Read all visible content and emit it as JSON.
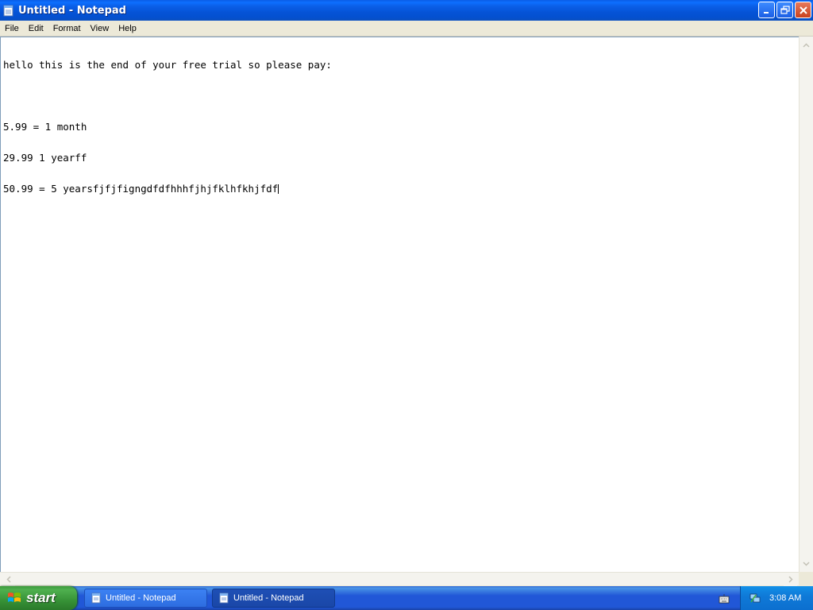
{
  "window": {
    "title": "Untitled - Notepad"
  },
  "menu": {
    "items": [
      "File",
      "Edit",
      "Format",
      "View",
      "Help"
    ]
  },
  "editor": {
    "lines": [
      "hello this is the end of your free trial so please pay:",
      "",
      "5.99 = 1 month",
      "29.99 1 yearff",
      "50.99 = 5 yearsfjfjfigngdfdfhhhfjhjfklhfkhjfdf"
    ]
  },
  "taskbar": {
    "start_label": "start",
    "buttons": [
      {
        "label": "Untitled - Notepad",
        "active": false
      },
      {
        "label": "Untitled - Notepad",
        "active": true
      }
    ],
    "clock": "3:08 AM"
  },
  "colors": {
    "titlebar": "#0553d6",
    "taskbar": "#2157d7",
    "start_button": "#379237",
    "close_button": "#c9411e"
  }
}
